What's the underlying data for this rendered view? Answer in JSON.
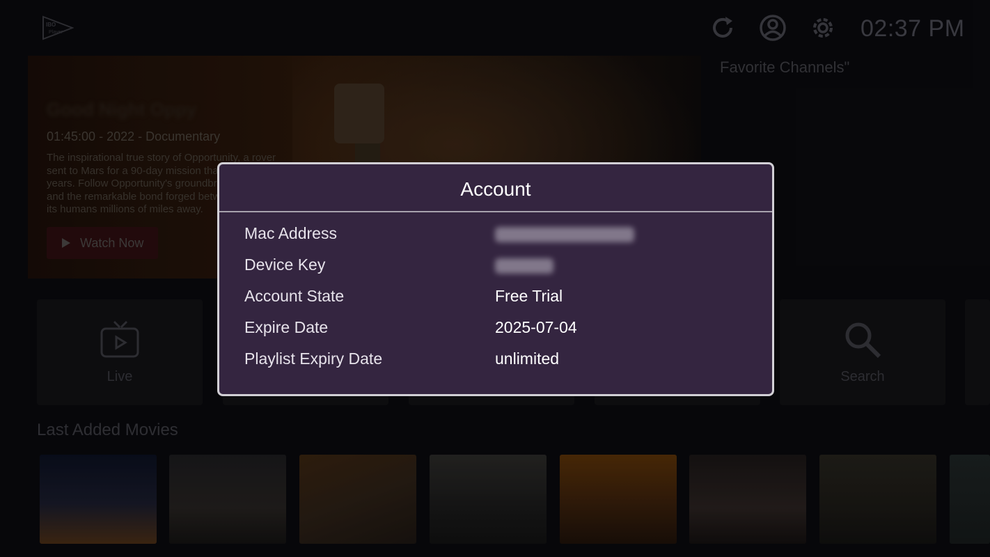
{
  "app": {
    "logo_text": "IBO Player"
  },
  "header": {
    "clock": "02:37 PM"
  },
  "hero": {
    "title": "Good Night Oppy",
    "meta": "01:45:00  -  2022  -  Documentary",
    "description": "The inspirational true story of Opportunity, a rover sent to Mars for a 90-day mission that survived 15 years. Follow Opportunity's groundbreaking journey and the remarkable bond forged between a robot and its humans millions of miles away.",
    "watch_label": "Watch Now"
  },
  "favorites": {
    "title": "Favorite Channels\""
  },
  "tiles": [
    {
      "label": "Live",
      "icon": "tv-icon"
    },
    {
      "label": "Search",
      "icon": "search-icon"
    }
  ],
  "movies": {
    "title": "Last Added Movies"
  },
  "account_modal": {
    "title": "Account",
    "rows": [
      {
        "key": "Mac Address",
        "value": ""
      },
      {
        "key": "Device Key",
        "value": ""
      },
      {
        "key": "Account State",
        "value": "Free Trial"
      },
      {
        "key": "Expire Date",
        "value": "2025-07-04"
      },
      {
        "key": "Playlist Expiry Date",
        "value": "unlimited"
      }
    ]
  },
  "colors": {
    "modal_bg": "#342540",
    "modal_border": "#d2d0d6",
    "page_bg": "#0a0a0e"
  }
}
